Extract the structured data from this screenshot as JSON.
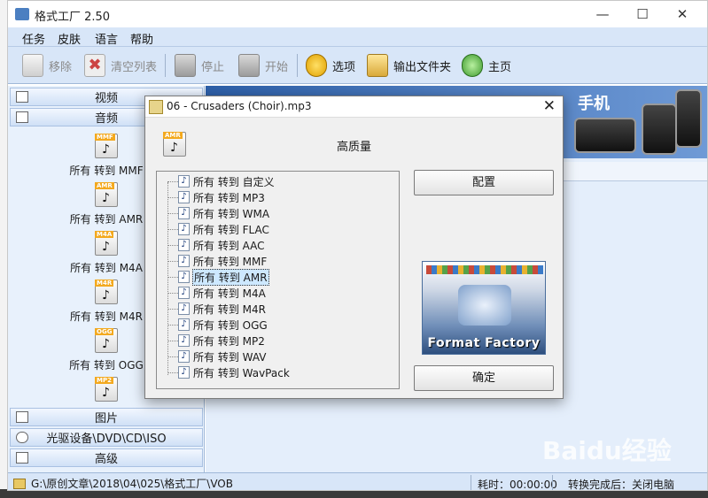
{
  "app": {
    "title": "格式工厂 2.50"
  },
  "menu": [
    "任务",
    "皮肤",
    "语言",
    "帮助"
  ],
  "toolbar": {
    "remove": "移除",
    "clear_list": "清空列表",
    "stop": "停止",
    "start": "开始",
    "options": "选项",
    "output_folder": "输出文件夹",
    "home": "主页"
  },
  "sidebar": {
    "categories": {
      "video": "视频",
      "audio": "音频",
      "picture": "图片",
      "disc": "光驱设备\\DVD\\CD\\ISO",
      "advanced": "高级"
    },
    "audio_items": [
      {
        "label": "所有 转到 MMF",
        "tag": "MMF"
      },
      {
        "label": "所有 转到 AMR",
        "tag": "AMR"
      },
      {
        "label": "所有 转到 M4A",
        "tag": "M4A"
      },
      {
        "label": "所有 转到 M4R",
        "tag": "M4R"
      },
      {
        "label": "所有 转到 OGG",
        "tag": "OGG"
      },
      {
        "label": "",
        "tag": "MP2"
      }
    ]
  },
  "banner": {
    "text": "手机"
  },
  "status": {
    "path": "G:\\原创文章\\2018\\04\\025\\格式工厂\\VOB",
    "time_label": "耗时：00:00:00",
    "after_label": "转换完成后：关闭电脑"
  },
  "dialog": {
    "title": "06 - Crusaders (Choir).mp3",
    "quality": "高质量",
    "icon_tag": "AMR",
    "config_button": "配置",
    "ok_button": "确定",
    "logo_text": "Format Factory",
    "tree_items": [
      {
        "label": "所有 转到 自定义",
        "selected": false
      },
      {
        "label": "所有 转到 MP3",
        "selected": false
      },
      {
        "label": "所有 转到 WMA",
        "selected": false
      },
      {
        "label": "所有 转到 FLAC",
        "selected": false
      },
      {
        "label": "所有 转到 AAC",
        "selected": false
      },
      {
        "label": "所有 转到 MMF",
        "selected": false
      },
      {
        "label": "所有 转到 AMR",
        "selected": true
      },
      {
        "label": "所有 转到 M4A",
        "selected": false
      },
      {
        "label": "所有 转到 M4R",
        "selected": false
      },
      {
        "label": "所有 转到 OGG",
        "selected": false
      },
      {
        "label": "所有 转到 MP2",
        "selected": false
      },
      {
        "label": "所有 转到 WAV",
        "selected": false
      },
      {
        "label": "所有 转到 WavPack",
        "selected": false
      }
    ]
  },
  "watermark": "Baidu经验"
}
